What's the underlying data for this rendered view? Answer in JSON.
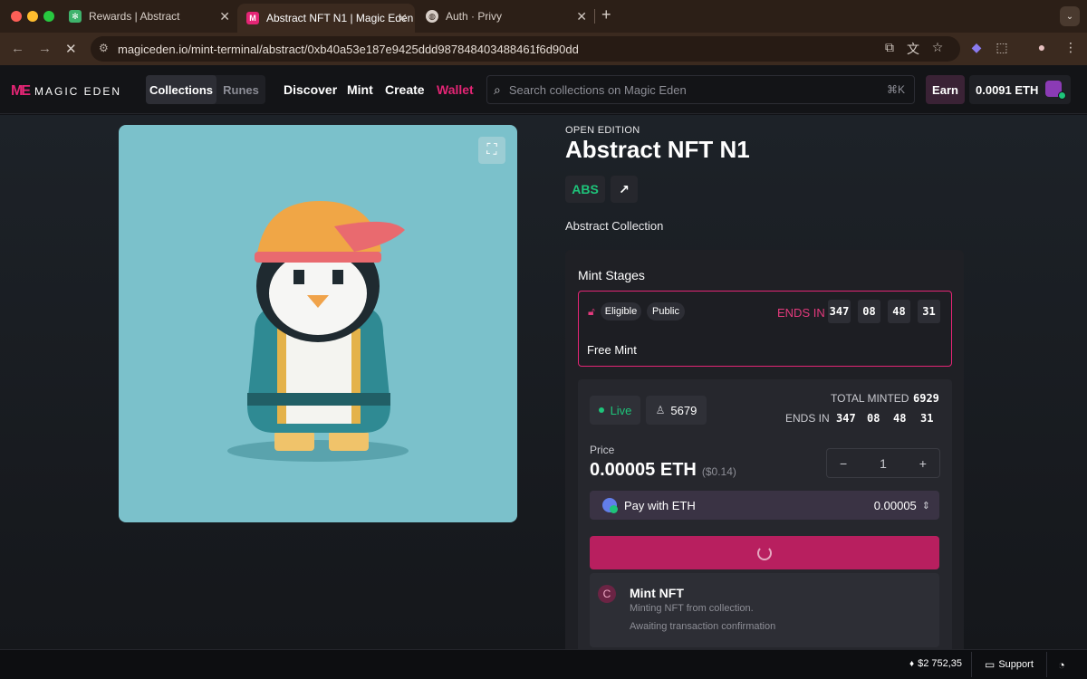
{
  "browser": {
    "tabs": [
      {
        "title": "Rewards | Abstract"
      },
      {
        "title": "Abstract NFT N1 | Magic Eden"
      },
      {
        "title": "Auth · Privy"
      }
    ],
    "url": "magiceden.io/mint-terminal/abstract/0xb40a53e187e9425ddd987848403488461f6d90dd"
  },
  "header": {
    "logo_text": "MAGIC EDEN",
    "segments": [
      "Collections",
      "Runes"
    ],
    "nav": [
      "Discover",
      "Mint",
      "Create",
      "Wallet"
    ],
    "search_placeholder": "Search collections on Magic Eden",
    "search_shortcut": "⌘K",
    "earn_label": "Earn",
    "balance": "0.0091 ETH"
  },
  "nft": {
    "kicker": "OPEN EDITION",
    "title": "Abstract NFT N1",
    "chain_chip": "ABS",
    "collection": "Abstract Collection"
  },
  "mint_stages": {
    "title": "Mint Stages",
    "stage": {
      "badges": [
        "Eligible",
        "Public"
      ],
      "ends_label": "ENDS IN",
      "countdown": [
        "347",
        "08",
        "48",
        "31"
      ],
      "name": "Free Mint"
    }
  },
  "mint_panel": {
    "status": "Live",
    "holders": "5679",
    "total_minted_label": "TOTAL MINTED",
    "total_minted": "6929",
    "ends_label": "ENDS IN",
    "countdown": [
      "347",
      "08",
      "48",
      "31"
    ],
    "price_label": "Price",
    "price": "0.00005 ETH",
    "price_usd": "($0.14)",
    "quantity": "1",
    "pay_label": "Pay with ETH",
    "pay_amount": "0.00005"
  },
  "toast": {
    "title": "Mint NFT",
    "line1": "Minting NFT from collection.",
    "line2": "Awaiting transaction confirmation"
  },
  "footer": {
    "eth_price": "$2 752,35",
    "support": "Support"
  },
  "colors": {
    "accent": "#e42575",
    "live": "#1ec47a",
    "mint_button": "#b81f5f"
  }
}
